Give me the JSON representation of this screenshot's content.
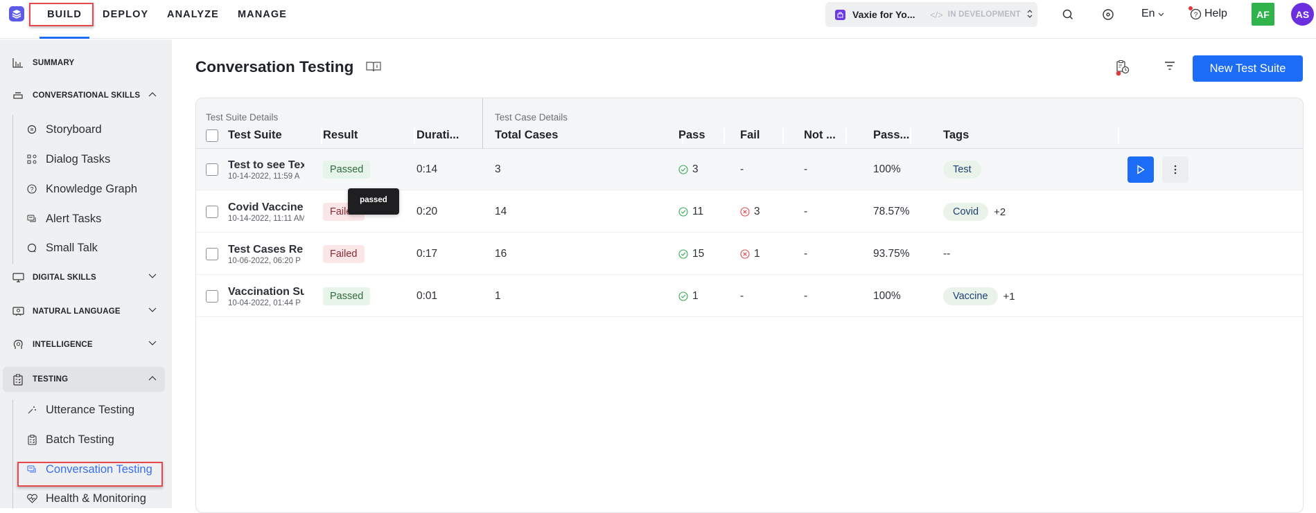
{
  "topnav": {
    "tabs": [
      {
        "label": "BUILD",
        "active": true,
        "highlighted": true
      },
      {
        "label": "DEPLOY",
        "active": false
      },
      {
        "label": "ANALYZE",
        "active": false
      },
      {
        "label": "MANAGE",
        "active": false
      }
    ],
    "app_switcher": {
      "app_name": "Vaxie for Yo...",
      "environment": "IN DEVELOPMENT"
    },
    "language": "En",
    "help_label": "Help",
    "avatars": [
      "AF",
      "AS"
    ],
    "icons": [
      "search-icon",
      "target-icon",
      "help-icon"
    ]
  },
  "sidebar": {
    "sections": [
      {
        "label": "SUMMARY",
        "icon": "chart-icon",
        "expandable": false
      },
      {
        "label": "CONVERSATIONAL SKILLS",
        "icon": "skills-icon",
        "expanded": true,
        "items": [
          {
            "label": "Storyboard",
            "icon": "storyboard-icon"
          },
          {
            "label": "Dialog Tasks",
            "icon": "dialog-icon"
          },
          {
            "label": "Knowledge Graph",
            "icon": "question-icon"
          },
          {
            "label": "Alert Tasks",
            "icon": "alert-chat-icon"
          },
          {
            "label": "Small Talk",
            "icon": "chat-bubble-icon"
          }
        ]
      },
      {
        "label": "DIGITAL SKILLS",
        "icon": "monitor-icon",
        "expanded": false
      },
      {
        "label": "NATURAL LANGUAGE",
        "icon": "nl-icon",
        "expanded": false
      },
      {
        "label": "INTELLIGENCE",
        "icon": "brain-icon",
        "expanded": false
      },
      {
        "label": "TESTING",
        "icon": "clipboard-icon",
        "expanded": true,
        "items": [
          {
            "label": "Utterance Testing",
            "icon": "wand-icon"
          },
          {
            "label": "Batch Testing",
            "icon": "clipboard-check-icon"
          },
          {
            "label": "Conversation Testing",
            "icon": "conversation-icon",
            "active": true,
            "highlighted": true
          },
          {
            "label": "Health & Monitoring",
            "icon": "heart-icon"
          }
        ]
      }
    ]
  },
  "main": {
    "title": "Conversation Testing",
    "new_button": "New Test Suite",
    "table": {
      "group_labels": [
        "Test Suite Details",
        "Test Case Details"
      ],
      "columns": [
        "Test Suite",
        "Result",
        "Durati...",
        "Total Cases",
        "Pass",
        "Fail",
        "Not ...",
        "Pass...",
        "Tags"
      ],
      "rows": [
        {
          "name": "Test to see Tex",
          "date": "10-14-2022, 11:59 A",
          "result": "Passed",
          "duration": "0:14",
          "total": "3",
          "pass": "3",
          "fail": "-",
          "not_run": "-",
          "pass_pct": "100%",
          "tag": "Test",
          "tag_more": ""
        },
        {
          "name": "Covid Vaccine",
          "date": "10-14-2022, 11:11 AM",
          "result": "Failed",
          "duration": "0:20",
          "total": "14",
          "pass": "11",
          "fail": "3",
          "not_run": "-",
          "pass_pct": "78.57%",
          "tag": "Covid",
          "tag_more": "+2"
        },
        {
          "name": "Test Cases Re",
          "date": "10-06-2022, 06:20 P",
          "result": "Failed",
          "duration": "0:17",
          "total": "16",
          "pass": "15",
          "fail": "1",
          "not_run": "-",
          "pass_pct": "93.75%",
          "tag": "",
          "tag_empty": "--",
          "tag_more": ""
        },
        {
          "name": "Vaccination Su",
          "date": "10-04-2022, 01:44 P",
          "result": "Passed",
          "duration": "0:01",
          "total": "1",
          "pass": "1",
          "fail": "-",
          "not_run": "-",
          "pass_pct": "100%",
          "tag": "Vaccine",
          "tag_more": "+1"
        }
      ]
    },
    "tooltip": "passed"
  },
  "colors": {
    "accent": "#1c6cf6",
    "passed_bg": "#e7f4ea",
    "failed_bg": "#fbe6e8",
    "highlight_box": "#e5484d",
    "pass_icon": "#2fa84f",
    "fail_icon": "#e5484d"
  }
}
